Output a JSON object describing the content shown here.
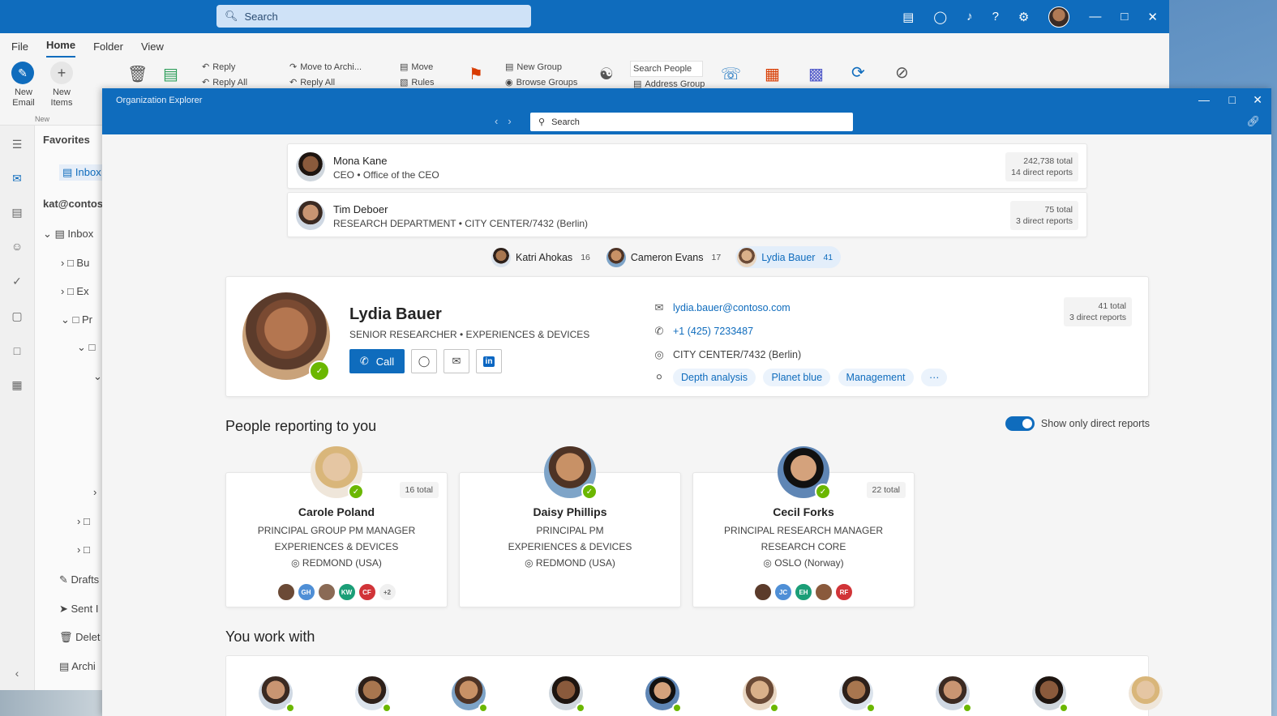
{
  "outlook": {
    "search_placeholder": "Search",
    "menu": [
      "File",
      "Home",
      "Folder",
      "View"
    ],
    "ribbon": {
      "new_email": "New Email",
      "new_items": "New Items",
      "new_group_label": "New",
      "reply": "Reply",
      "reply_all": "Reply All",
      "move_to_archive": "Move to Archi...",
      "move": "Move",
      "rules": "Rules",
      "new_group": "New Group",
      "browse_groups": "Browse Groups",
      "search_people": "Search People",
      "address_book": "Address Group"
    },
    "folders": {
      "favorites": "Favorites",
      "inbox_fav": "Inbox",
      "account": "kat@contoso",
      "inbox": "Inbox",
      "sub1": "Bu",
      "sub2": "Ex",
      "sub3": "Pr",
      "drafts": "Drafts",
      "sent": "Sent I",
      "deleted": "Delet",
      "archive": "Archi"
    }
  },
  "org_explorer": {
    "title": "Organization Explorer",
    "search_placeholder": "Search",
    "chain": [
      {
        "name": "Mona Kane",
        "subtitle": "CEO • Office of the CEO",
        "total": "242,738 total",
        "direct": "14 direct reports"
      },
      {
        "name": "Tim Deboer",
        "subtitle": "RESEARCH DEPARTMENT • CITY CENTER/7432 (Berlin)",
        "total": "75 total",
        "direct": "3 direct reports"
      }
    ],
    "peers": [
      {
        "name": "Katri Ahokas",
        "count": "16"
      },
      {
        "name": "Cameron Evans",
        "count": "17"
      },
      {
        "name": "Lydia Bauer",
        "count": "41"
      }
    ],
    "profile": {
      "name": "Lydia Bauer",
      "title": "SENIOR RESEARCHER • EXPERIENCES & DEVICES",
      "call_label": "Call",
      "email": "lydia.bauer@contoso.com",
      "phone": "+1 (425) 7233487",
      "location": "CITY CENTER/7432 (Berlin)",
      "skills": [
        "Depth analysis",
        "Planet blue",
        "Management"
      ],
      "more_label": "···",
      "total": "41 total",
      "direct": "3 direct reports"
    },
    "reporting_title": "People reporting to you",
    "toggle_label": "Show only direct reports",
    "reports": [
      {
        "name": "Carole Poland",
        "title": "PRINCIPAL GROUP PM MANAGER",
        "org": "EXPERIENCES & DEVICES",
        "location": "REDMOND (USA)",
        "total": "16 total",
        "minis": [
          {
            "label": "",
            "color": "#6b4a36"
          },
          {
            "label": "GH",
            "color": "#4f8fd6"
          },
          {
            "label": "",
            "color": "#8a6a55"
          },
          {
            "label": "KW",
            "color": "#1b9e77"
          },
          {
            "label": "CF",
            "color": "#d13438"
          },
          {
            "label": "+2",
            "color": "#f0f0f0"
          }
        ]
      },
      {
        "name": "Daisy Phillips",
        "title": "PRINCIPAL PM",
        "org": "EXPERIENCES & DEVICES",
        "location": "REDMOND (USA)",
        "total": "",
        "minis": []
      },
      {
        "name": "Cecil Forks",
        "title": "PRINCIPAL RESEARCH MANAGER",
        "org": "RESEARCH CORE",
        "location": "OSLO (Norway)",
        "total": "22 total",
        "minis": [
          {
            "label": "",
            "color": "#5b3b2b"
          },
          {
            "label": "JC",
            "color": "#4f8fd6"
          },
          {
            "label": "EH",
            "color": "#1b9e77"
          },
          {
            "label": "",
            "color": "#8a5a3c"
          },
          {
            "label": "RF",
            "color": "#d13438"
          }
        ]
      }
    ],
    "work_title": "You work with"
  },
  "colors": {
    "accent": "#0f6cbd",
    "presence": "#6bb700"
  }
}
